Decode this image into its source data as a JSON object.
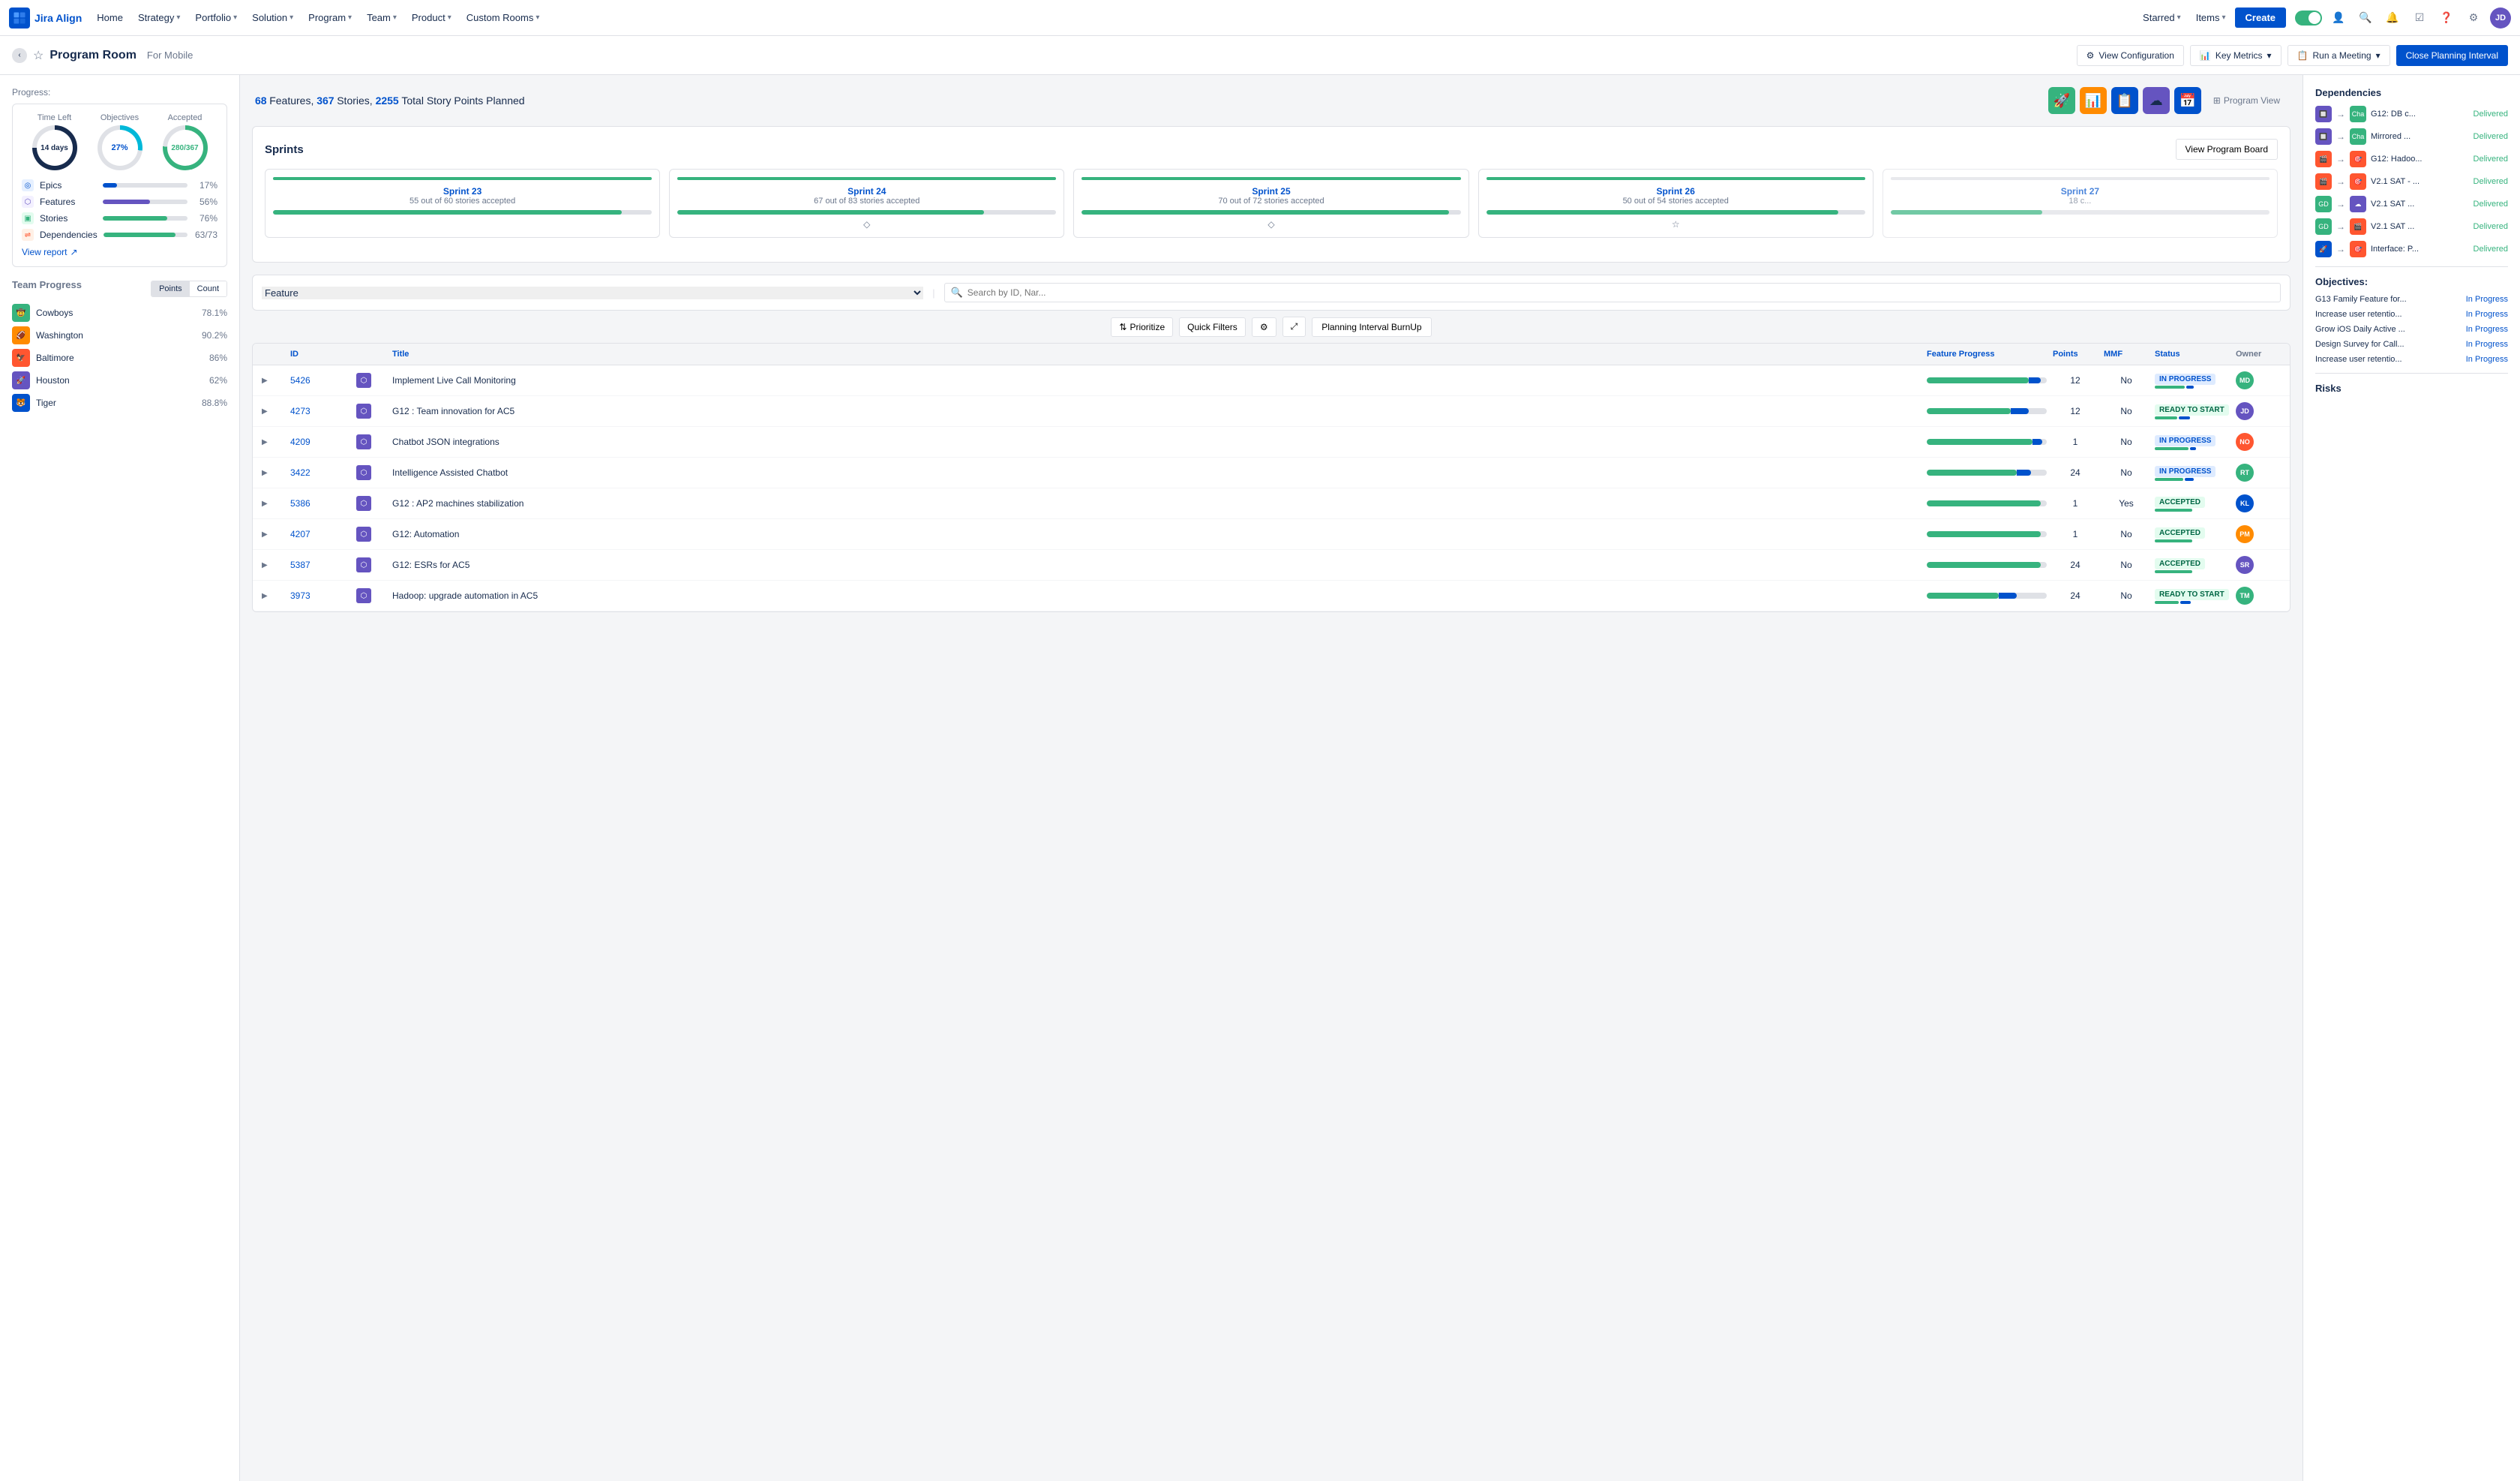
{
  "nav": {
    "logo_text": "Jira Align",
    "items": [
      {
        "label": "Home"
      },
      {
        "label": "Strategy",
        "has_chevron": true
      },
      {
        "label": "Portfolio",
        "has_chevron": true
      },
      {
        "label": "Solution",
        "has_chevron": true
      },
      {
        "label": "Program",
        "has_chevron": true
      },
      {
        "label": "Team",
        "has_chevron": true
      },
      {
        "label": "Product",
        "has_chevron": true
      },
      {
        "label": "Custom Rooms",
        "has_chevron": true
      },
      {
        "label": "Starred",
        "has_chevron": true
      },
      {
        "label": "Items",
        "has_chevron": true
      }
    ],
    "create_label": "Create"
  },
  "subnav": {
    "page_title": "Program Room",
    "page_subtitle": "For  Mobile",
    "view_config_label": "View Configuration",
    "key_metrics_label": "Key Metrics",
    "run_meeting_label": "Run a Meeting",
    "close_label": "Close Planning Interval"
  },
  "summary": {
    "features_count": "68",
    "stories_count": "367",
    "story_points": "2255",
    "text": "Features, ",
    "text2": " Stories, ",
    "text3": " Total Story Points Planned"
  },
  "program_view_label": "Program View",
  "progress": {
    "title": "Progress:",
    "time_left_label": "Time Left",
    "objectives_label": "Objectives",
    "accepted_label": "Accepted",
    "time_left_value": "14 days",
    "objectives_value": "27%",
    "accepted_value": "280/367",
    "bars": [
      {
        "label": "Epics",
        "icon_color": "#0052cc",
        "pct": 17,
        "pct_label": "17%",
        "color": "#0052cc"
      },
      {
        "label": "Features",
        "icon_color": "#6554c0",
        "pct": 56,
        "pct_label": "56%",
        "color": "#6554c0"
      },
      {
        "label": "Stories",
        "icon_color": "#36b37e",
        "pct": 76,
        "pct_label": "76%",
        "color": "#36b37e"
      },
      {
        "label": "Dependencies",
        "icon_color": "#ff5630",
        "pct": 86,
        "pct_label": "63/73",
        "color": "#36b37e"
      }
    ],
    "view_report_label": "View report"
  },
  "team_progress": {
    "title": "Team Progress",
    "tabs": [
      "Points",
      "Count"
    ],
    "teams": [
      {
        "name": "Cowboys",
        "pct": "78.1%",
        "color": "#36b37e"
      },
      {
        "name": "Washington",
        "pct": "90.2%",
        "color": "#ff8b00"
      },
      {
        "name": "Baltimore",
        "pct": "86%",
        "color": "#ff5630"
      },
      {
        "name": "Houston",
        "pct": "62%",
        "color": "#6554c0"
      },
      {
        "name": "Tiger",
        "pct": "88.8%",
        "color": "#0052cc"
      }
    ]
  },
  "sprints": {
    "title": "Sprints",
    "view_board_label": "View Program Board",
    "items": [
      {
        "name": "Sprint 23",
        "stories": "55 out of 60 stories accepted",
        "pct": 92,
        "has_diamond": false
      },
      {
        "name": "Sprint 24",
        "stories": "67 out of 83 stories accepted",
        "pct": 81,
        "has_diamond": true
      },
      {
        "name": "Sprint 25",
        "stories": "70 out of 72 stories accepted",
        "pct": 97,
        "has_diamond": true
      },
      {
        "name": "Sprint 26",
        "stories": "50 out of 54 stories accepted",
        "pct": 93,
        "has_diamond": false
      },
      {
        "name": "Sprint 27",
        "stories": "18 c...",
        "pct": 40,
        "has_star": true
      }
    ]
  },
  "feature_list": {
    "filter_label": "Feature",
    "search_placeholder": "Search by ID, Nar...",
    "prioritize_label": "Prioritize",
    "quick_filters_label": "Quick Filters",
    "burnup_label": "Planning Interval BurnUp",
    "headers": [
      "ID",
      "Title",
      "Feature Progress",
      "Points",
      "MMF",
      "Status",
      "Owner"
    ],
    "rows": [
      {
        "id": "5426",
        "title": "Implement Live Call Monitoring",
        "points": 12,
        "mmf": "No",
        "status": "IN PROGRESS",
        "status_class": "in-progress",
        "progress_pct": 85,
        "icon_color": "#6554c0"
      },
      {
        "id": "4273",
        "title": "G12 : Team innovation for AC5",
        "points": 12,
        "mmf": "No",
        "status": "READY TO START",
        "status_class": "ready",
        "progress_pct": 70,
        "icon_color": "#6554c0"
      },
      {
        "id": "4209",
        "title": "Chatbot JSON integrations",
        "points": 1,
        "mmf": "No",
        "status": "IN PROGRESS",
        "status_class": "in-progress",
        "progress_pct": 88,
        "icon_color": "#6554c0"
      },
      {
        "id": "3422",
        "title": "Intelligence Assisted Chatbot",
        "points": 24,
        "mmf": "No",
        "status": "IN PROGRESS",
        "status_class": "in-progress",
        "progress_pct": 75,
        "icon_color": "#6554c0"
      },
      {
        "id": "5386",
        "title": "G12 : AP2 machines stabilization",
        "points": 1,
        "mmf": "Yes",
        "status": "ACCEPTED",
        "status_class": "accepted",
        "progress_pct": 95,
        "icon_color": "#6554c0"
      },
      {
        "id": "4207",
        "title": "G12: Automation",
        "points": 1,
        "mmf": "No",
        "status": "ACCEPTED",
        "status_class": "accepted",
        "progress_pct": 95,
        "icon_color": "#6554c0"
      },
      {
        "id": "5387",
        "title": "G12: ESRs for AC5",
        "points": 24,
        "mmf": "No",
        "status": "ACCEPTED",
        "status_class": "accepted",
        "progress_pct": 95,
        "icon_color": "#6554c0"
      },
      {
        "id": "3973",
        "title": "Hadoop: upgrade automation in AC5",
        "points": 24,
        "mmf": "No",
        "status": "READY TO START",
        "status_class": "ready",
        "progress_pct": 60,
        "icon_color": "#6554c0"
      }
    ]
  },
  "right_panel": {
    "dependencies_title": "Dependencies",
    "dependencies": [
      {
        "from_color": "#6554c0",
        "to_color": "#36b37e",
        "to_label": "Cha",
        "name": "G12: DB c...",
        "status": "Delivered"
      },
      {
        "from_color": "#6554c0",
        "to_color": "#36b37e",
        "to_label": "Cha",
        "name": "Mirrored ...",
        "status": "Delivered"
      },
      {
        "from_color": "#ff5630",
        "to_color": "#ff5630",
        "to_label": "🎯",
        "name": "G12: Hadoo...",
        "status": "Delivered"
      },
      {
        "from_color": "#ff5630",
        "to_color": "#ff5630",
        "to_label": "🎯",
        "name": "V2.1 SAT - ...",
        "status": "Delivered"
      },
      {
        "from_color": "#36b37e",
        "to_color": "#6554c0",
        "to_label": "☁",
        "name": "V2.1 SAT ...",
        "status": "Delivered"
      },
      {
        "from_color": "#36b37e",
        "to_color": "#ff5630",
        "to_label": "🎯",
        "name": "V2.1 SAT ...",
        "status": "Delivered"
      },
      {
        "from_color": "#0052cc",
        "to_color": "#ff5630",
        "to_label": "🎯",
        "name": "Interface: P...",
        "status": "Delivered"
      }
    ],
    "objectives_title": "Objectives:",
    "objectives": [
      {
        "name": "G13 Family Feature for...",
        "status": "In Progress"
      },
      {
        "name": "Increase user retentio...",
        "status": "In Progress"
      },
      {
        "name": "Grow iOS Daily Active ...",
        "status": "In Progress"
      },
      {
        "name": "Design Survey for Call...",
        "status": "In Progress"
      },
      {
        "name": "Increase user retentio...",
        "status": "In Progress"
      }
    ],
    "risks_title": "Risks"
  }
}
